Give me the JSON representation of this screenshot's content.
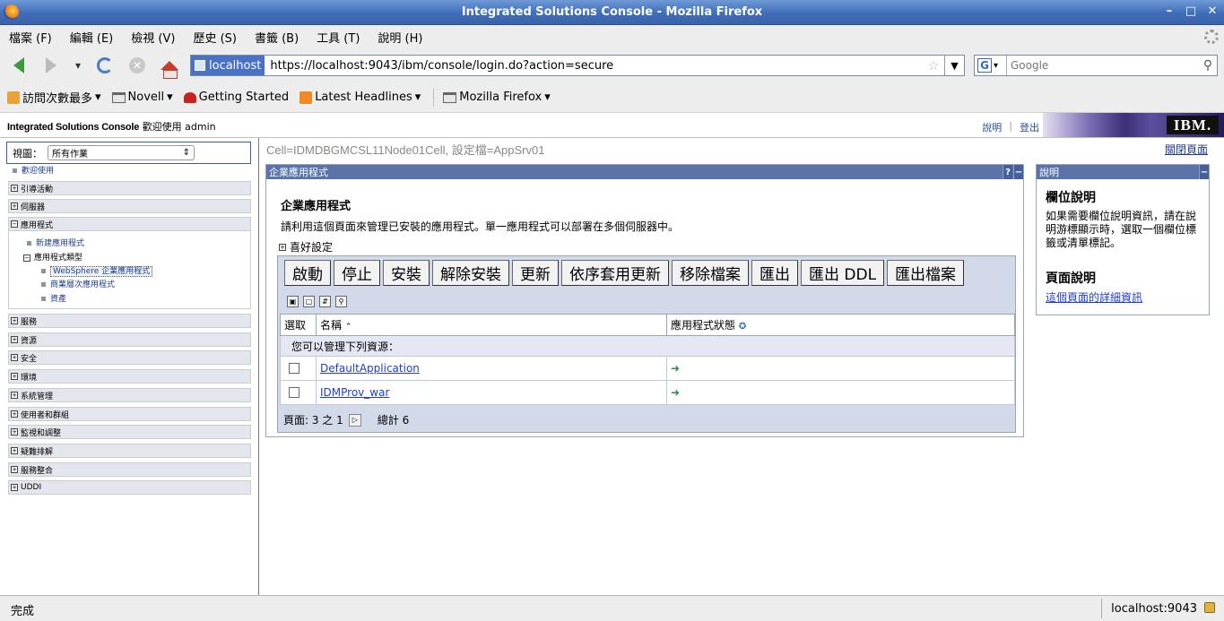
{
  "window": {
    "title": "Integrated Solutions Console - Mozilla Firefox",
    "controls": [
      "–",
      "□",
      "✕"
    ]
  },
  "menu": [
    "檔案 (F)",
    "編輯 (E)",
    "檢視 (V)",
    "歷史 (S)",
    "書籤 (B)",
    "工具 (T)",
    "說明 (H)"
  ],
  "nav": {
    "site_label": "localhost",
    "url": "https://localhost:9043/ibm/console/login.do?action=secure",
    "search_placeholder": "Google"
  },
  "bookmarks": [
    "訪問次數最多",
    "Novell",
    "Getting  Started",
    "Latest Headlines",
    "Mozilla  Firefox"
  ],
  "banner": {
    "console_name": "Integrated Solutions Console",
    "welcome": "歡迎使用  admin",
    "help_link": "說明",
    "logout_link": "登出",
    "ibm_logo": "IBM."
  },
  "leftnav": {
    "view_label": "視圖：",
    "view_value": "所有作業",
    "welcome_link": "歡迎使用",
    "sections": [
      "引導活動",
      "伺服器",
      "應用程式",
      "服務",
      "資源",
      "安全",
      "環境",
      "系統管理",
      "使用者和群組",
      "監視和調整",
      "疑難排解",
      "服務整合",
      "UDDI"
    ],
    "apps_children": {
      "new_app": "新建應用程式",
      "app_types": "應用程式類型",
      "websphere_apps": "WebSphere 企業應用程式",
      "business_apps": "商業層次應用程式",
      "assets": "資產"
    }
  },
  "content": {
    "cell_info": "Cell=IDMDBGMCSL11Node01Cell, 設定檔=AppSrv01",
    "close_page": "關閉頁面",
    "portlet_title": "企業應用程式",
    "page_title": "企業應用程式",
    "description": "請利用這個頁面來管理已安裝的應用程式。單一應用程式可以部署在多個伺服器中。",
    "preferences": "喜好設定",
    "buttons": [
      "啟動",
      "停止",
      "安裝",
      "解除安裝",
      "更新",
      "依序套用更新",
      "移除檔案",
      "匯出",
      "匯出 DDL",
      "匯出檔案"
    ],
    "columns": {
      "select": "選取",
      "name": "名稱",
      "status": "應用程式狀態"
    },
    "manage_note": "您可以管理下列資源：",
    "rows": [
      {
        "name": "DefaultApplication",
        "status": "running"
      },
      {
        "name": "IDMProv_war",
        "status": "running"
      }
    ],
    "pager": {
      "page_text": "頁面: 3 之 1",
      "total_text": "總計 6"
    }
  },
  "help": {
    "title": "說明",
    "field_help_title": "欄位說明",
    "field_help_text": "如果需要欄位說明資訊，請在說明游標顯示時，選取一個欄位標籤或清單標記。",
    "page_help_title": "頁面說明",
    "page_help_link": "這個頁面的詳細資訊"
  },
  "status": {
    "text": "完成",
    "host": "localhost:9043"
  }
}
